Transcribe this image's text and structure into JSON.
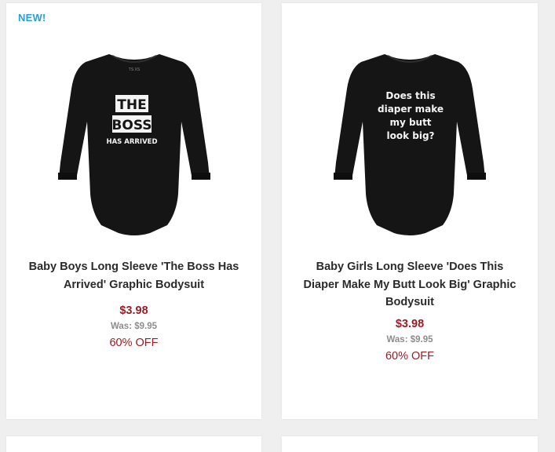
{
  "products": [
    {
      "badge": "NEW!",
      "title": "Baby Boys Long Sleeve 'The Boss Has Arrived' Graphic Bodysuit",
      "sale_price": "$3.98",
      "was_price": "Was: $9.95",
      "discount": "60% OFF",
      "graphic_lines": [
        "THE",
        "BOSS",
        "HAS ARRIVED"
      ],
      "tag_text": "TS XS"
    },
    {
      "title": "Baby Girls Long Sleeve 'Does This Diaper Make My Butt Look Big' Graphic Bodysuit",
      "sale_price": "$3.98",
      "was_price": "Was: $9.95",
      "discount": "60% OFF",
      "graphic_lines": [
        "Does this",
        "diaper make",
        "my butt",
        "look big?"
      ]
    }
  ],
  "colors": {
    "badge": "#2a9fd6",
    "sale_price": "#9b1c24",
    "was_price": "#8d8d8d",
    "title": "#2b2b2b",
    "page_background": "#efefef",
    "card_background": "#ffffff",
    "garment": "#151515"
  }
}
